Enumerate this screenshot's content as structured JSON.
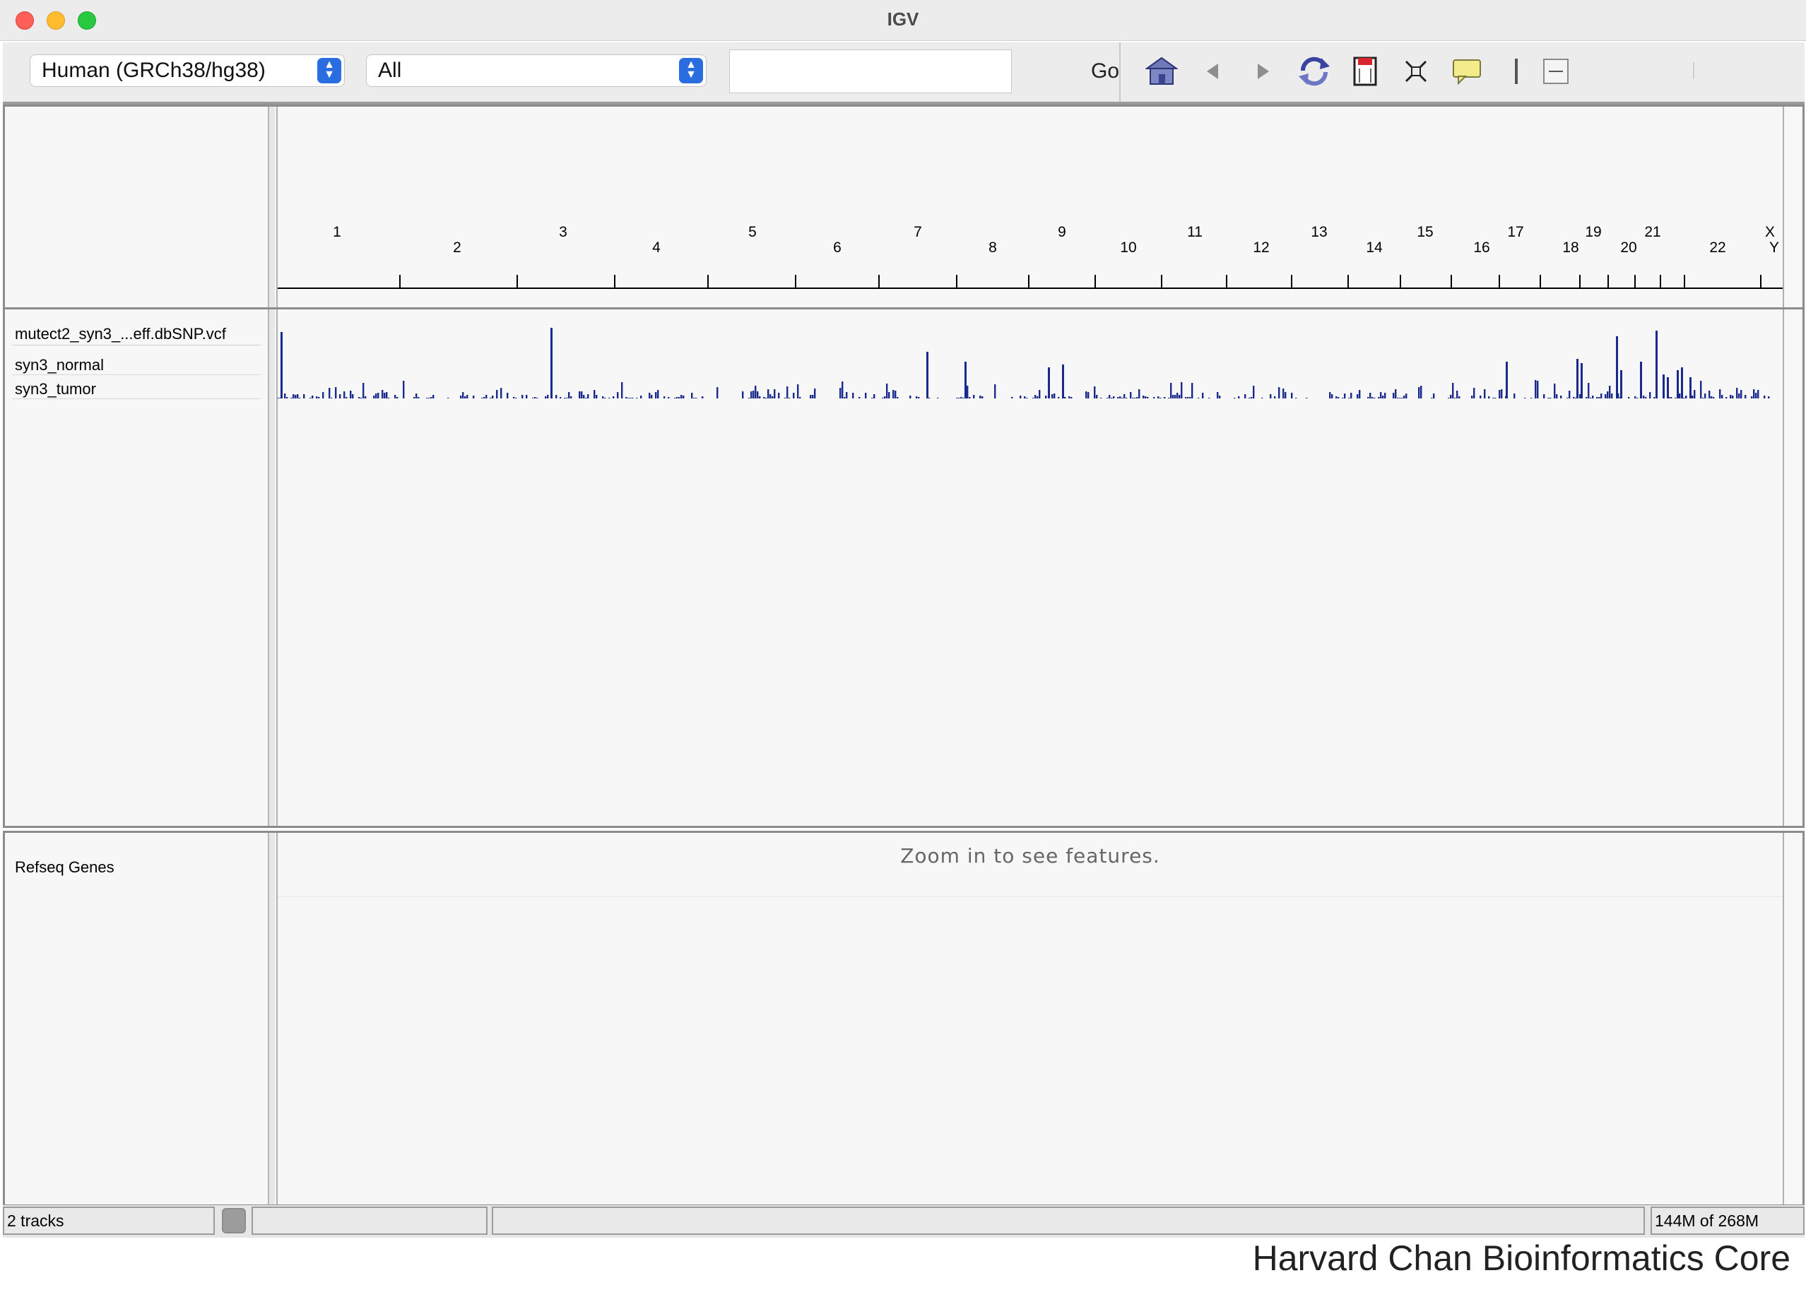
{
  "window": {
    "title": "IGV"
  },
  "toolbar": {
    "genome": "Human (GRCh38/hg38)",
    "chromosome": "All",
    "locus": "",
    "go_label": "Go",
    "icons": [
      "home-icon",
      "back-icon",
      "forward-icon",
      "refresh-icon",
      "roi-icon",
      "fit-to-window-icon",
      "popup-info-icon",
      "resize-handle-icon",
      "collapse-icon"
    ]
  },
  "ruler": {
    "chromosomes": [
      "1",
      "2",
      "3",
      "4",
      "5",
      "6",
      "7",
      "8",
      "9",
      "10",
      "11",
      "12",
      "13",
      "14",
      "15",
      "16",
      "17",
      "18",
      "19",
      "20",
      "21",
      "22",
      "X",
      "Y"
    ]
  },
  "data_panel": {
    "track_name": "mutect2_syn3_...eff.dbSNP.vcf",
    "samples": [
      "syn3_normal",
      "syn3_tumor"
    ]
  },
  "feature_panel": {
    "track_name": "Refseq Genes",
    "message": "Zoom in to see features."
  },
  "status": {
    "tracks": "2 tracks",
    "memory": "144M of 268M"
  },
  "footer": {
    "credit": "Harvard Chan Bioinformatics Core"
  },
  "colors": {
    "bars": "#1a2a8c",
    "background": "#f8f7f7"
  }
}
